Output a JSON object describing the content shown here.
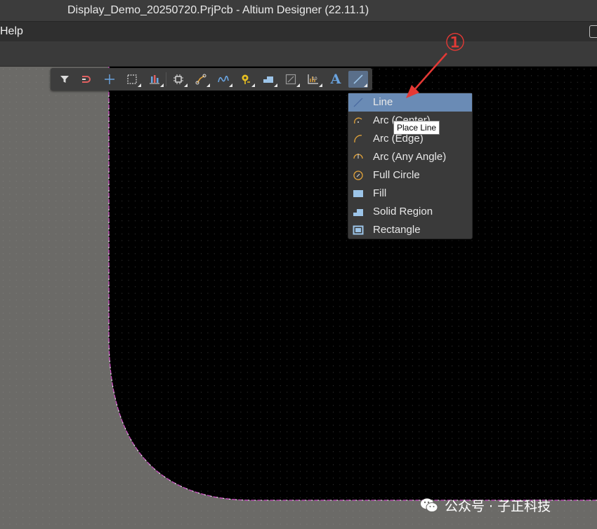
{
  "window": {
    "title": "Display_Demo_20250720.PrjPcb - Altium Designer (22.11.1)"
  },
  "menubar": {
    "help_label": "Help"
  },
  "toolbar": {
    "buttons": [
      {
        "name": "filter-icon"
      },
      {
        "name": "snap-icon"
      },
      {
        "name": "cross-icon"
      },
      {
        "name": "select-rect-icon"
      },
      {
        "name": "align-icon"
      },
      {
        "name": "component-icon"
      },
      {
        "name": "route-icon"
      },
      {
        "name": "diff-pair-icon"
      },
      {
        "name": "via-icon"
      },
      {
        "name": "region-icon"
      },
      {
        "name": "dimension-icon"
      },
      {
        "name": "chart-icon"
      },
      {
        "name": "text-icon",
        "text": "A"
      },
      {
        "name": "line-icon"
      }
    ]
  },
  "dropdown": {
    "items": [
      {
        "label": "Line",
        "icon": "line-icon"
      },
      {
        "label": "Arc (Center)",
        "icon": "arc-center-icon"
      },
      {
        "label": "Arc (Edge)",
        "icon": "arc-edge-icon"
      },
      {
        "label": "Arc (Any Angle)",
        "icon": "arc-any-angle-icon"
      },
      {
        "label": "Full Circle",
        "icon": "full-circle-icon"
      },
      {
        "label": "Fill",
        "icon": "fill-icon"
      },
      {
        "label": "Solid Region",
        "icon": "solid-region-icon"
      },
      {
        "label": "Rectangle",
        "icon": "rectangle-icon"
      }
    ]
  },
  "tooltip": {
    "text": "Place Line"
  },
  "annotation": {
    "marker": "①"
  },
  "watermark": {
    "text": "公众号 · 子正科技"
  },
  "colors": {
    "board": "#000000",
    "board_outline": "#c94bbf",
    "grid_dots": "#3a3a3a",
    "selection": "#6a8bb5",
    "annotation": "#e53935",
    "icon_orange": "#e2a33a",
    "icon_blue": "#9cc4e8"
  }
}
